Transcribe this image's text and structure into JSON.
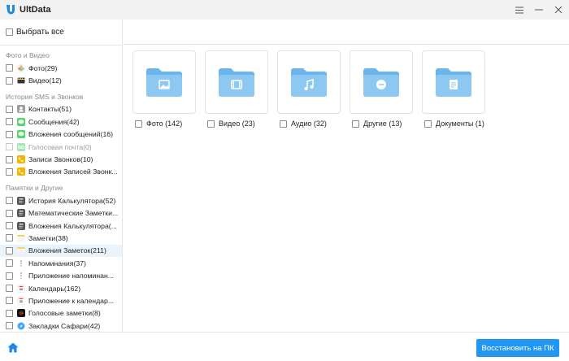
{
  "app": {
    "title": "UltData"
  },
  "window": {
    "menu_icon": "menu-icon",
    "minimize_icon": "minimize-icon",
    "close_icon": "close-icon"
  },
  "sidebar": {
    "select_all": "Выбрать все",
    "groups": [
      {
        "title": "Фото и Видео",
        "items": [
          {
            "label": "Фото(29)",
            "icon": "photos-icon"
          },
          {
            "label": "Видео(12)",
            "icon": "video-icon"
          }
        ]
      },
      {
        "title": "История SMS и Звонков",
        "items": [
          {
            "label": "Контакты(51)",
            "icon": "contacts-icon"
          },
          {
            "label": "Сообщения(42)",
            "icon": "messages-icon"
          },
          {
            "label": "Вложения сообщений(16)",
            "icon": "message-attachments-icon"
          },
          {
            "label": "Голосовая почта(0)",
            "icon": "voicemail-icon",
            "disabled": true
          },
          {
            "label": "Записи Звонков(10)",
            "icon": "call-history-icon"
          },
          {
            "label": "Вложения Записей Звонк...",
            "icon": "call-attachments-icon"
          }
        ]
      },
      {
        "title": "Памятки и Другие",
        "items": [
          {
            "label": "История Калькулятора(52)",
            "icon": "calculator-icon"
          },
          {
            "label": "Математические Заметки...",
            "icon": "calculator-icon"
          },
          {
            "label": "Вложения Калькулятора(...",
            "icon": "calculator-icon"
          },
          {
            "label": "Заметки(38)",
            "icon": "notes-icon"
          },
          {
            "label": "Вложения Заметок(211)",
            "icon": "notes-icon",
            "selected": true
          },
          {
            "label": "Напоминания(37)",
            "icon": "reminders-icon"
          },
          {
            "label": "Приложение напоминан...",
            "icon": "reminders-icon"
          },
          {
            "label": "Календарь(162)",
            "icon": "calendar-icon"
          },
          {
            "label": "Приложение к календар...",
            "icon": "calendar-icon"
          },
          {
            "label": "Голосовые заметки(8)",
            "icon": "voice-memos-icon"
          },
          {
            "label": "Закладки Сафари(42)",
            "icon": "safari-icon"
          }
        ]
      }
    ]
  },
  "main": {
    "categories": [
      {
        "label": "Фото (142)",
        "icon": "photo-folder-icon"
      },
      {
        "label": "Видео (23)",
        "icon": "video-folder-icon"
      },
      {
        "label": "Аудио (32)",
        "icon": "audio-folder-icon"
      },
      {
        "label": "Другие (13)",
        "icon": "other-folder-icon"
      },
      {
        "label": "Документы (1)",
        "icon": "document-folder-icon"
      }
    ]
  },
  "footer": {
    "restore_label": "Восстановить на ПК",
    "home_icon": "home-icon"
  },
  "colors": {
    "accent": "#2196f3",
    "folder": "#8cc8f2",
    "folder_dark": "#6bb5ea",
    "selected_bg": "#e9f3fc"
  }
}
